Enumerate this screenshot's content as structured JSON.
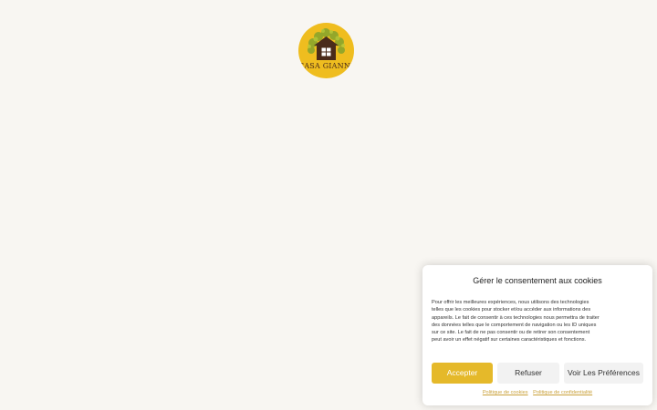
{
  "logo": {
    "text": "CASA GIANNE",
    "background": "#efbd1f",
    "icon": "house-tree-icon"
  },
  "cookie_banner": {
    "title": "Gérer le consentement aux cookies",
    "body": "Pour offrir les meilleures expériences, nous utilisons des technologies telles que les cookies pour stocker et/ou accéder aux informations des appareils. Le fait de consentir à ces technologies nous permettra de traiter des données telles que le comportement de navigation ou les ID uniques sur ce site. Le fait de ne pas consentir ou de retirer son consentement peut avoir un effet négatif sur certaines caractéristiques et fonctions.",
    "accept_label": "Accepter",
    "refuse_label": "Refuser",
    "preferences_label": "Voir Les Préférences",
    "cookie_policy_link": "Politique de cookies",
    "privacy_policy_link": "Politique de confidentialité",
    "accent_color": "#e5b92a"
  }
}
